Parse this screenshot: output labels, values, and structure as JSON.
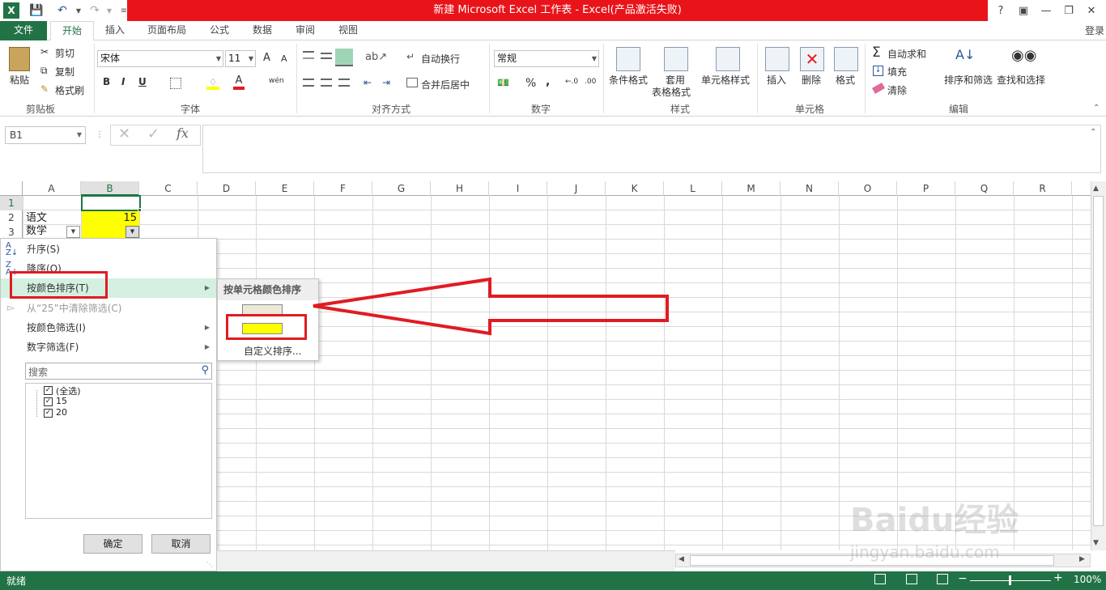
{
  "window": {
    "title": "新建 Microsoft Excel 工作表 - Excel(产品激活失败)",
    "help": "?",
    "login": "登录"
  },
  "tabs": [
    "文件",
    "开始",
    "插入",
    "页面布局",
    "公式",
    "数据",
    "审阅",
    "视图"
  ],
  "ribbon": {
    "clipboard": {
      "paste": "粘贴",
      "cut": "剪切",
      "copy": "复制",
      "format_painter": "格式刷",
      "label": "剪贴板"
    },
    "font": {
      "name": "宋体",
      "size": "11",
      "bold": "B",
      "italic": "I",
      "underline": "U",
      "grow": "A",
      "shrink": "A",
      "wen": "wén",
      "label": "字体"
    },
    "align": {
      "wrap": "自动换行",
      "merge": "合并后居中",
      "label": "对齐方式"
    },
    "number": {
      "format": "常规",
      "percent": "%",
      "comma": ",",
      "label": "数字"
    },
    "styles": {
      "cond": "条件格式",
      "table1": "套用",
      "table2": "表格格式",
      "cell": "单元格样式",
      "label": "样式"
    },
    "cells": {
      "insert": "插入",
      "delete": "删除",
      "format": "格式",
      "label": "单元格"
    },
    "editing": {
      "autosum": "自动求和",
      "fill": "填充",
      "clear": "清除",
      "sort": "排序和筛选",
      "find": "查找和选择",
      "label": "编辑"
    }
  },
  "formula_bar": {
    "name_box": "B1",
    "fx": "fx",
    "value": ""
  },
  "columns": [
    "A",
    "B",
    "C",
    "D",
    "E",
    "F",
    "G",
    "H",
    "I",
    "J",
    "K",
    "L",
    "M",
    "N",
    "O",
    "P",
    "Q",
    "R"
  ],
  "rows": [
    "1",
    "2",
    "3"
  ],
  "cells": {
    "a2": "语文",
    "b2": "15",
    "a3": "数学"
  },
  "filter_menu": {
    "sort_asc": "升序(S)",
    "sort_desc": "降序(O)",
    "sort_by_color": "按颜色排序(T)",
    "clear_filter": "从“25”中清除筛选(C)",
    "filter_by_color": "按颜色筛选(I)",
    "number_filter": "数字筛选(F)",
    "search_placeholder": "搜索",
    "items": [
      "(全选)",
      "15",
      "20"
    ],
    "ok": "确定",
    "cancel": "取消"
  },
  "submenu": {
    "title": "按单元格颜色排序",
    "colors": [
      "#ece9d8",
      "#ffff00"
    ],
    "custom": "自定义排序..."
  },
  "status": {
    "ready": "就绪",
    "zoom": "100%"
  },
  "watermark": {
    "brand": "Baidu经验",
    "url": "jingyan.baidu.com"
  },
  "colors": {
    "accent": "#217346",
    "title_red": "#e8141a",
    "highlight_red": "#e11b22",
    "cell_yellow": "#ffff00"
  }
}
